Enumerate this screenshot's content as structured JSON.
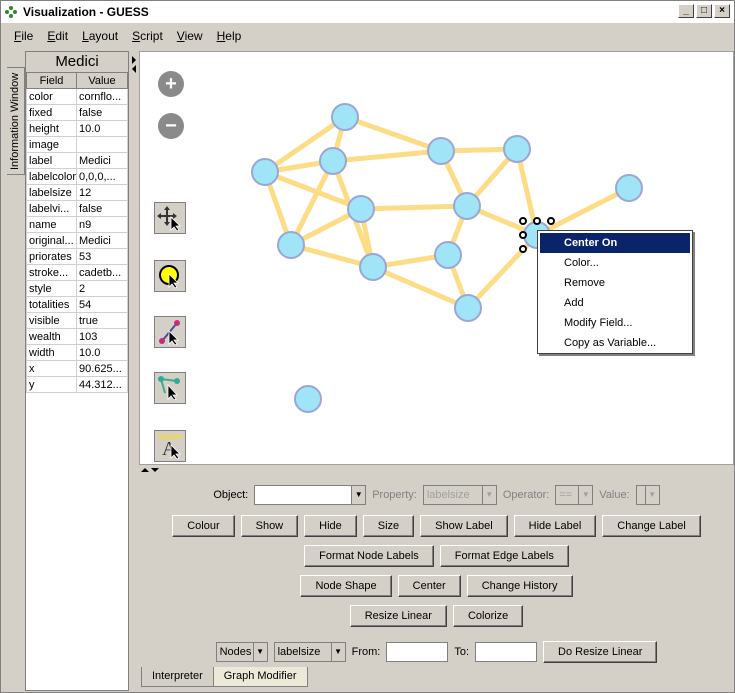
{
  "window": {
    "title": "Visualization - GUESS"
  },
  "menu": [
    {
      "label": "File",
      "u": "F",
      "rest": "ile"
    },
    {
      "label": "Edit",
      "u": "E",
      "rest": "dit"
    },
    {
      "label": "Layout",
      "u": "L",
      "rest": "ayout"
    },
    {
      "label": "Script",
      "u": "S",
      "rest": "cript"
    },
    {
      "label": "View",
      "u": "V",
      "rest": "iew"
    },
    {
      "label": "Help",
      "u": "H",
      "rest": "elp"
    }
  ],
  "info": {
    "tab_label": "Information Window",
    "title": "Medici",
    "col_field": "Field",
    "col_value": "Value",
    "rows": [
      [
        "color",
        "cornflo..."
      ],
      [
        "fixed",
        "false"
      ],
      [
        "height",
        "10.0"
      ],
      [
        "image",
        ""
      ],
      [
        "label",
        "Medici"
      ],
      [
        "labelcolor",
        "0,0,0,..."
      ],
      [
        "labelsize",
        "12"
      ],
      [
        "labelvi...",
        "false"
      ],
      [
        "name",
        "n9"
      ],
      [
        "original...",
        "Medici"
      ],
      [
        "priorates",
        "53"
      ],
      [
        "stroke...",
        "cadetb..."
      ],
      [
        "style",
        "2"
      ],
      [
        "totalities",
        "54"
      ],
      [
        "visible",
        "true"
      ],
      [
        "wealth",
        "103"
      ],
      [
        "width",
        "10.0"
      ],
      [
        "x",
        "90.625..."
      ],
      [
        "y",
        "44.312..."
      ]
    ]
  },
  "context_menu": [
    "Center On",
    "Color...",
    "Remove",
    "Add",
    "Modify Field...",
    "Copy as Variable..."
  ],
  "controls": {
    "object_label": "Object:",
    "property_label": "Property:",
    "property_value": "labelsize",
    "operator_label": "Operator:",
    "operator_value": "==",
    "value_label": "Value:",
    "row1": [
      "Colour",
      "Show",
      "Hide",
      "Size",
      "Show Label",
      "Hide Label",
      "Change Label"
    ],
    "row2": [
      "Format Node Labels",
      "Format Edge Labels"
    ],
    "row3": [
      "Node Shape",
      "Center",
      "Change History"
    ],
    "row4": [
      "Resize Linear",
      "Colorize"
    ],
    "nodes_select": "Nodes",
    "field_select": "labelsize",
    "from_label": "From:",
    "to_label": "To:",
    "do_resize": "Do Resize Linear"
  },
  "tabs": [
    "Interpreter",
    "Graph Modifier"
  ],
  "colors": {
    "node_fill": "#9fe4f7",
    "node_stroke": "#9ba6d6",
    "edge": "#fddc86",
    "menu_highlight": "#0a246a"
  }
}
